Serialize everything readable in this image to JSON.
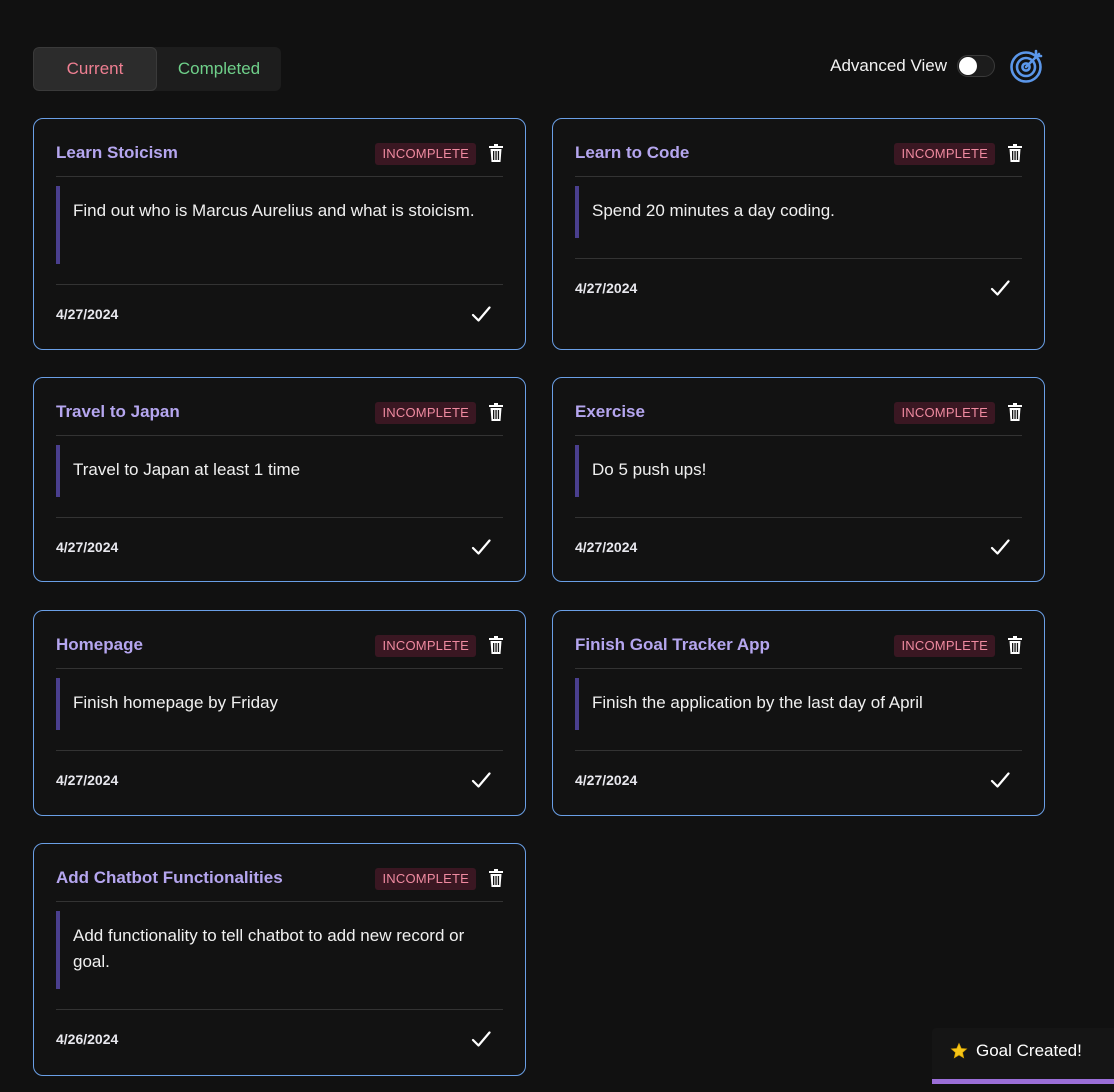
{
  "tabs": {
    "current": "Current",
    "completed": "Completed"
  },
  "advanced_view": {
    "label": "Advanced View",
    "enabled": false
  },
  "goals": [
    {
      "title": "Learn Stoicism",
      "status": "INCOMPLETE",
      "description": "Find out who is Marcus Aurelius and what is stoicism.",
      "date": "4/27/2024"
    },
    {
      "title": "Learn to Code",
      "status": "INCOMPLETE",
      "description": "Spend 20 minutes a day coding.",
      "date": "4/27/2024"
    },
    {
      "title": "Travel to Japan",
      "status": "INCOMPLETE",
      "description": "Travel to Japan at least 1 time",
      "date": "4/27/2024"
    },
    {
      "title": "Exercise",
      "status": "INCOMPLETE",
      "description": "Do 5 push ups!",
      "date": "4/27/2024"
    },
    {
      "title": "Homepage",
      "status": "INCOMPLETE",
      "description": "Finish homepage by Friday",
      "date": "4/27/2024"
    },
    {
      "title": "Finish Goal Tracker App",
      "status": "INCOMPLETE",
      "description": "Finish the application by the last day of April",
      "date": "4/27/2024"
    },
    {
      "title": "Add Chatbot Functionalities",
      "status": "INCOMPLETE",
      "description": "Add functionality to tell chatbot to add new record or goal.",
      "date": "4/26/2024"
    }
  ],
  "toast": {
    "icon": "star-icon",
    "message": "Goal Created!"
  },
  "colors": {
    "accent_border": "#6a9fe6",
    "title": "#b5a6ef",
    "badge_bg": "#3a1722",
    "badge_text": "#ef8aa0",
    "current_tab": "#ef7f92",
    "completed_tab": "#6fd08a"
  }
}
